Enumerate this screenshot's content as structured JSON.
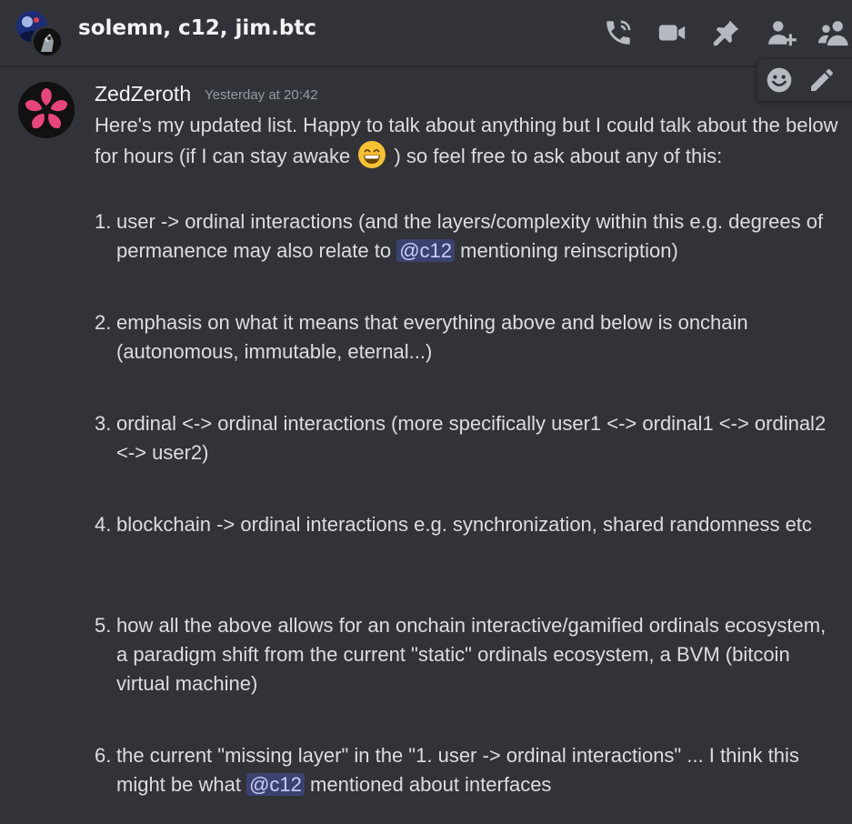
{
  "header": {
    "title": "solemn, c12, jim.btc",
    "icons": [
      "phone-call-icon",
      "video-camera-icon",
      "pin-icon",
      "add-friends-icon",
      "members-icon"
    ]
  },
  "toolbar": {
    "icons": [
      "add-reaction-icon",
      "edit-pencil-icon"
    ]
  },
  "message": {
    "author": "ZedZeroth",
    "timestamp": "Yesterday at 20:42",
    "intro_part1": "Here's my updated list. Happy to talk about anything but I could talk about the below for hours (if I can stay awake",
    "emoji": "😄",
    "intro_part2": ") so feel free to ask about any of this:",
    "items": [
      {
        "num": "1.",
        "before": "user -> ordinal interactions (and the layers/complexity within this e.g. degrees of permanence may also relate to",
        "mention": "@c12",
        "after": "mentioning reinscription)"
      },
      {
        "num": "2.",
        "text": "emphasis on what it means that everything above and below is onchain (autonomous, immutable, eternal...)"
      },
      {
        "num": "3.",
        "text": "ordinal <-> ordinal interactions (more specifically user1 <-> ordinal1 <-> ordinal2 <-> user2)"
      },
      {
        "num": "4.",
        "text": "blockchain -> ordinal interactions e.g. synchronization, shared randomness etc"
      },
      {
        "num": "5.",
        "text": "how all the above allows for an onchain interactive/gamified ordinals ecosystem, a paradigm shift from the current \"static\" ordinals ecosystem, a BVM (bitcoin virtual machine)"
      },
      {
        "num": "6.",
        "before": "the current \"missing layer\" in the \"1. user -> ordinal interactions\" ... I think this might be what",
        "mention": "@c12",
        "after": " mentioned about interfaces"
      }
    ]
  },
  "colors": {
    "background": "#313338",
    "text": "#dbdee1",
    "mention_bg": "#3c4270",
    "mention_text": "#c9cdfb",
    "muted": "#949ba4"
  }
}
